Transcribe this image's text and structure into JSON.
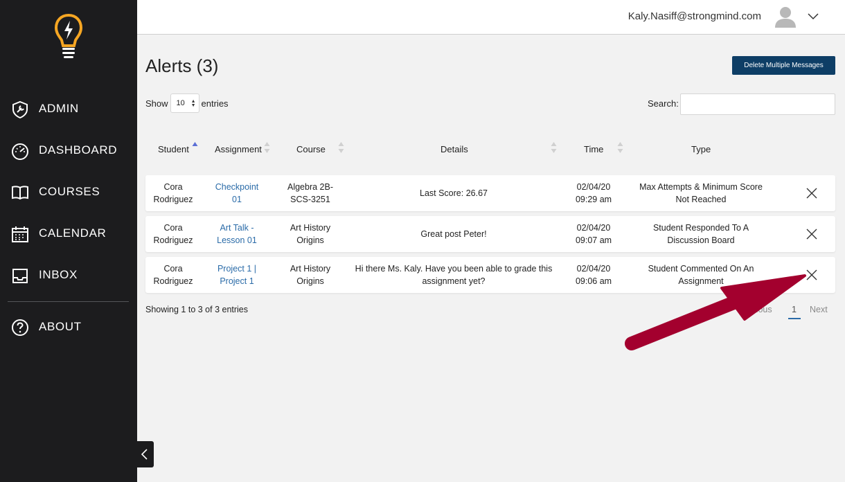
{
  "sidebar": {
    "items": [
      {
        "label": "ADMIN"
      },
      {
        "label": "DASHBOARD"
      },
      {
        "label": "COURSES"
      },
      {
        "label": "CALENDAR"
      },
      {
        "label": "INBOX"
      },
      {
        "label": "ABOUT"
      }
    ]
  },
  "topbar": {
    "email": "Kaly.Nasiff@strongmind.com"
  },
  "main": {
    "title": "Alerts (3)",
    "delete_label": "Delete Multiple Messages",
    "show_label": "Show",
    "show_value": "10",
    "entries_label": "entries",
    "search_label": "Search:",
    "search_value": ""
  },
  "table": {
    "headers": [
      "Student",
      "Assignment",
      "Course",
      "Details",
      "Time",
      "Type"
    ],
    "rows": [
      {
        "student": [
          "Cora",
          "Rodriguez"
        ],
        "assignment": [
          "Checkpoint",
          "01"
        ],
        "course": [
          "Algebra 2B-",
          "SCS-3251"
        ],
        "details": [
          "Last Score: 26.67"
        ],
        "time": [
          "02/04/20",
          "09:29 am"
        ],
        "type": [
          "Max Attempts & Minimum Score",
          "Not Reached"
        ]
      },
      {
        "student": [
          "Cora",
          "Rodriguez"
        ],
        "assignment": [
          "Art Talk -",
          "Lesson 01"
        ],
        "course": [
          "Art History",
          "Origins"
        ],
        "details": [
          "Great post Peter!"
        ],
        "time": [
          "02/04/20",
          "09:07 am"
        ],
        "type": [
          "Student Responded To A",
          "Discussion Board"
        ]
      },
      {
        "student": [
          "Cora",
          "Rodriguez"
        ],
        "assignment": [
          "Project 1 |",
          "Project 1"
        ],
        "course": [
          "Art History",
          "Origins"
        ],
        "details": [
          "Hi there Ms. Kaly. Have you been able to grade this",
          "assignment yet?"
        ],
        "time": [
          "02/04/20",
          "09:06 am"
        ],
        "type": [
          "Student Commented On An",
          "Assignment"
        ]
      }
    ]
  },
  "footer": {
    "info": "Showing 1 to 3 of 3 entries",
    "previous": "Previous",
    "page": "1",
    "next": "Next"
  },
  "colors": {
    "sidebar_bg": "#1c1c1e",
    "accent_button": "#0e3e66",
    "link": "#2a6ba8",
    "logo": "#f6a623",
    "annotation_arrow": "#a3002e"
  },
  "icons": [
    "lightbulb-logo-icon",
    "shield-wrench-icon",
    "speedometer-icon",
    "open-book-icon",
    "calendar-icon",
    "inbox-tray-icon",
    "question-circle-icon",
    "user-avatar-icon",
    "chevron-down-icon",
    "close-icon",
    "chevron-left-icon",
    "sort-arrows-icon"
  ]
}
